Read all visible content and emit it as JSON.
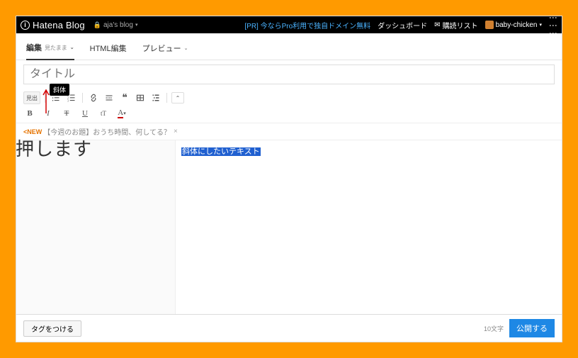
{
  "topbar": {
    "logo": "Hatena Blog",
    "blog_name": "aja's blog",
    "pr_link": "[PR] 今ならPro利用で独自ドメイン無料",
    "nav_dashboard": "ダッシュボード",
    "nav_delivery": "購読リスト",
    "username": "baby-chicken"
  },
  "tabs": {
    "edit_label": "編集",
    "edit_sub": "見たまま",
    "html_label": "HTML編集",
    "preview_label": "プレビュー"
  },
  "title_placeholder": "タイトル",
  "tooltip_italic": "斜体",
  "toolbar": {
    "heading": "見出",
    "bold": "B",
    "italic": "I",
    "strike": "T",
    "underline": "U",
    "fontsize": "tT",
    "color": "A"
  },
  "prompt": {
    "new_tag": "<NEW",
    "text": "【今週のお題】おうち時間、何してる？",
    "close": "×"
  },
  "editor": {
    "selected_text": "斜体にしたいテキスト"
  },
  "footer": {
    "tag_button": "タグをつける",
    "char_count": "10文字",
    "publish": "公開する"
  },
  "annotation": {
    "instruction": "押します"
  }
}
